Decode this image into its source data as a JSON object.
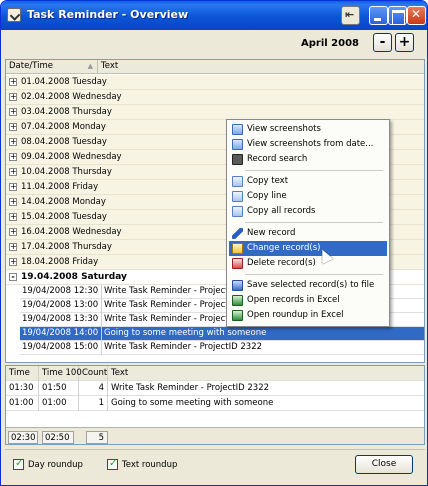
{
  "window": {
    "title": "Task Reminder - Overview"
  },
  "nav": {
    "month": "April 2008",
    "prev_label": "-",
    "next_label": "+"
  },
  "top_grid": {
    "headers": [
      "Date/Time",
      "Text"
    ],
    "groups": [
      {
        "label": "01.04.2008 Tuesday",
        "toggle": "+"
      },
      {
        "label": "02.04.2008 Wednesday",
        "toggle": "+"
      },
      {
        "label": "03.04.2008 Thursday",
        "toggle": "+"
      },
      {
        "label": "07.04.2008 Monday",
        "toggle": "+"
      },
      {
        "label": "08.04.2008 Tuesday",
        "toggle": "+"
      },
      {
        "label": "09.04.2008 Wednesday",
        "toggle": "+"
      },
      {
        "label": "10.04.2008 Thursday",
        "toggle": "+"
      },
      {
        "label": "11.04.2008 Friday",
        "toggle": "+"
      },
      {
        "label": "14.04.2008 Monday",
        "toggle": "+"
      },
      {
        "label": "15.04.2008 Tuesday",
        "toggle": "+"
      },
      {
        "label": "16.04.2008 Wednesday",
        "toggle": "+"
      },
      {
        "label": "17.04.2008 Thursday",
        "toggle": "+"
      },
      {
        "label": "18.04.2008 Friday",
        "toggle": "+"
      },
      {
        "label": "19.04.2008 Saturday",
        "toggle": "-"
      }
    ],
    "records": [
      {
        "datetime": "19/04/2008 12:30",
        "text": "Write Task Reminder - ProjectID 2322"
      },
      {
        "datetime": "19/04/2008 13:00",
        "text": "Write Task Reminder - ProjectID 2322"
      },
      {
        "datetime": "19/04/2008 13:30",
        "text": "Write Task Reminder - ProjectID 2322"
      },
      {
        "datetime": "19/04/2008 14:00",
        "text": "Going to some meeting with someone"
      },
      {
        "datetime": "19/04/2008 15:00",
        "text": "Write Task Reminder - ProjectID 2322"
      }
    ],
    "selected_record_index": 3
  },
  "context_menu": {
    "items": [
      {
        "label": "View screenshots",
        "icon": "screenshot-icon"
      },
      {
        "label": "View screenshots from date...",
        "icon": "screenshot-date-icon"
      },
      {
        "label": "Record search",
        "icon": "binoculars-icon"
      },
      {
        "label": "Copy text",
        "icon": "copy-icon"
      },
      {
        "label": "Copy line",
        "icon": "copy-line-icon"
      },
      {
        "label": "Copy all records",
        "icon": "copy-all-icon"
      },
      {
        "label": "New record",
        "icon": "pencil-icon"
      },
      {
        "label": "Change record(s)",
        "icon": "edit-record-icon"
      },
      {
        "label": "Delete record(s)",
        "icon": "delete-record-icon"
      },
      {
        "label": "Save selected record(s) to file",
        "icon": "save-icon"
      },
      {
        "label": "Open records in Excel",
        "icon": "excel-icon"
      },
      {
        "label": "Open roundup in Excel",
        "icon": "excel-roundup-icon"
      }
    ],
    "hovered_item": "Change record(s)"
  },
  "summary_grid": {
    "headers": [
      "Time",
      "Time 100",
      "Count",
      "Text"
    ],
    "rows": [
      {
        "time": "01:30",
        "time100": "01:50",
        "count": "4",
        "text": "Write Task Reminder - ProjectID 2322"
      },
      {
        "time": "01:00",
        "time100": "01:00",
        "count": "1",
        "text": "Going to some meeting with someone"
      }
    ],
    "totals": {
      "time": "02:30",
      "time100": "02:50",
      "count": "5"
    }
  },
  "footer": {
    "day_roundup": {
      "label": "Day roundup",
      "checked": true
    },
    "text_roundup": {
      "label": "Text roundup",
      "checked": true
    },
    "close_label": "Close"
  },
  "colors": {
    "selection": "#316ac5",
    "titlebar": "#0b55d6",
    "window_bg": "#ece9d8"
  }
}
